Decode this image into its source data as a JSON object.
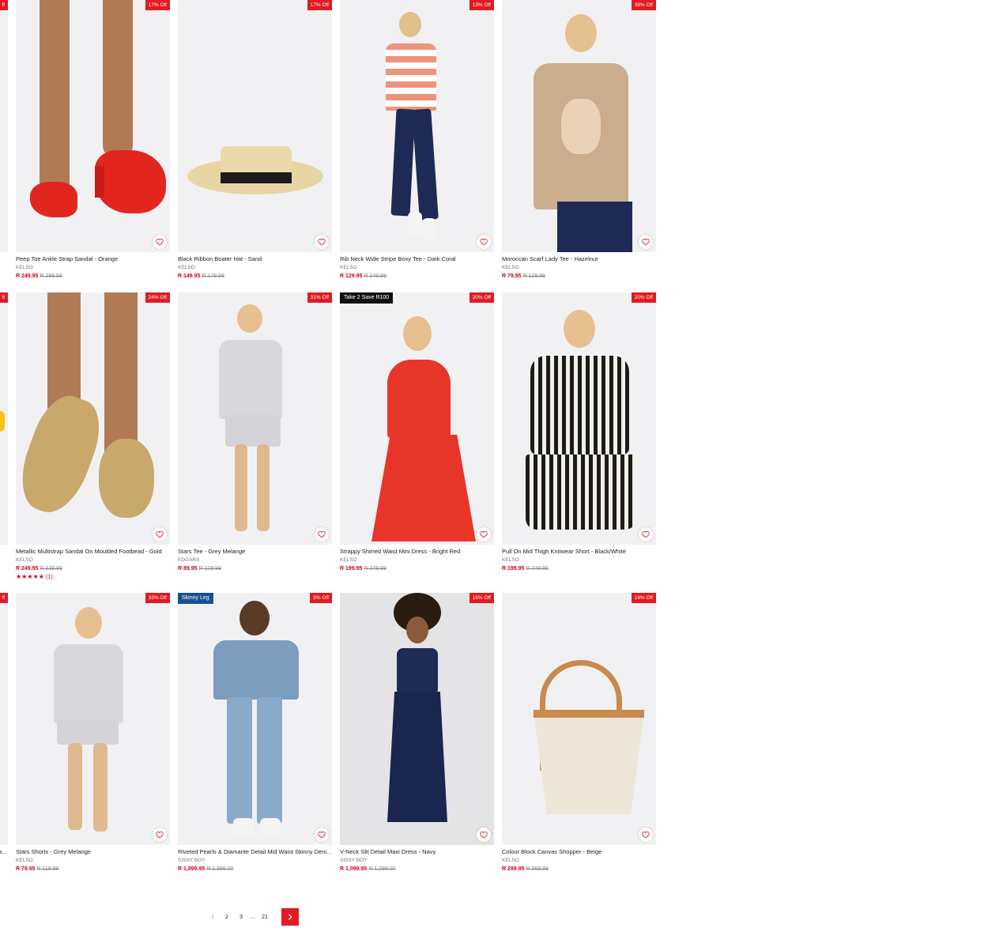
{
  "colors": {
    "accent": "#e11b22",
    "price": "#d0021b"
  },
  "partials": {
    "r1": {
      "badge": "ff"
    },
    "r2": {
      "badge": "ff"
    },
    "r3": {
      "badge": "ff",
      "name": "a..."
    }
  },
  "products": [
    {
      "name": "Peep Toe Ankle Strap Sandal - Orange",
      "brand": "KELSO",
      "price": "R 249.95",
      "was": "R 299.99",
      "badge": "17% Off"
    },
    {
      "name": "Black Ribbon Boater Hat - Sand",
      "brand": "KELSO",
      "price": "R 149.95",
      "was": "R 179.99",
      "badge": "17% Off"
    },
    {
      "name": "Rib Neck Wide Stripe Boxy Tee - Dark Coral",
      "brand": "KELSO",
      "price": "R 129.95",
      "was": "R 149.99",
      "badge": "13% Off"
    },
    {
      "name": "Moroccan Scarf Lady Tee - Hazelnut",
      "brand": "KELSO",
      "price": "R 79.95",
      "was": "R 129.99",
      "badge": "38% Off"
    },
    {
      "name": "Metallic Multistrap Sandal On Moulded Footbead - Gold",
      "brand": "KELSO",
      "price": "R 249.95",
      "was": "R 329.99",
      "badge": "24% Off",
      "rating": "★★★★★",
      "rating_count": "(1)"
    },
    {
      "name": "Stars Tee - Grey Melange",
      "brand": "EDGARS",
      "price": "R 89.95",
      "was": "R 129.99",
      "badge": "31% Off"
    },
    {
      "name": "Strappy Shirred Waist Mini Dress - Bright Red",
      "brand": "KELSO",
      "price": "R 199.95",
      "was": "R 249.99",
      "badge": "20% Off",
      "promo": "Take 2 Save R100"
    },
    {
      "name": "Pull On Mid Thigh Knitwear Short - Black/White",
      "brand": "KELSO",
      "price": "R 199.95",
      "was": "R 249.95",
      "badge": "20% Off"
    },
    {
      "name": "Stars Shorts - Grey Melange",
      "brand": "KELSO",
      "price": "R 79.95",
      "was": "R 119.99",
      "badge": "33% Off"
    },
    {
      "name": "Riveted Pearls & Diamante Detail Mid Waist Skinny Denim ...",
      "brand": "SISSY BOY",
      "price": "R 1,899.95",
      "was": "R 1,999.00",
      "badge": "5% Off",
      "promo": "Skinny Leg"
    },
    {
      "name": "V-Neck Slit Detail Maxi Dress - Navy",
      "brand": "SISSY BOY",
      "price": "R 1,099.95",
      "was": "R 1,299.00",
      "badge": "15% Off"
    },
    {
      "name": "Colour Block Canvas Shopper - Beige",
      "brand": "KELSO",
      "price": "R 299.95",
      "was": "R 369.99",
      "badge": "19% Off"
    }
  ],
  "pagination": {
    "pages": [
      "1",
      "2",
      "3",
      "...",
      "21"
    ],
    "current": "1",
    "next_icon": "chevron-right-icon"
  }
}
